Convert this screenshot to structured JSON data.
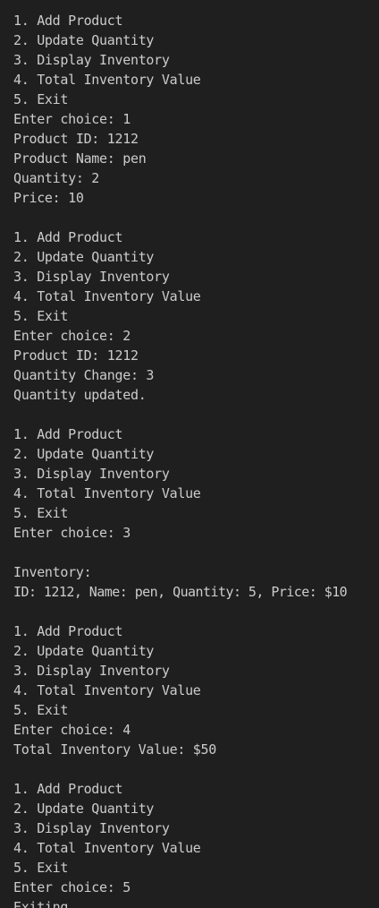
{
  "terminal": {
    "lines": [
      "1. Add Product",
      "2. Update Quantity",
      "3. Display Inventory",
      "4. Total Inventory Value",
      "5. Exit",
      "Enter choice: 1",
      "Product ID: 1212",
      "Product Name: pen",
      "Quantity: 2",
      "Price: 10",
      "",
      "1. Add Product",
      "2. Update Quantity",
      "3. Display Inventory",
      "4. Total Inventory Value",
      "5. Exit",
      "Enter choice: 2",
      "Product ID: 1212",
      "Quantity Change: 3",
      "Quantity updated.",
      "",
      "1. Add Product",
      "2. Update Quantity",
      "3. Display Inventory",
      "4. Total Inventory Value",
      "5. Exit",
      "Enter choice: 3",
      "",
      "Inventory:",
      "ID: 1212, Name: pen, Quantity: 5, Price: $10",
      "",
      "1. Add Product",
      "2. Update Quantity",
      "3. Display Inventory",
      "4. Total Inventory Value",
      "5. Exit",
      "Enter choice: 4",
      "Total Inventory Value: $50",
      "",
      "1. Add Product",
      "2. Update Quantity",
      "3. Display Inventory",
      "4. Total Inventory Value",
      "5. Exit",
      "Enter choice: 5",
      "Exiting..."
    ]
  }
}
